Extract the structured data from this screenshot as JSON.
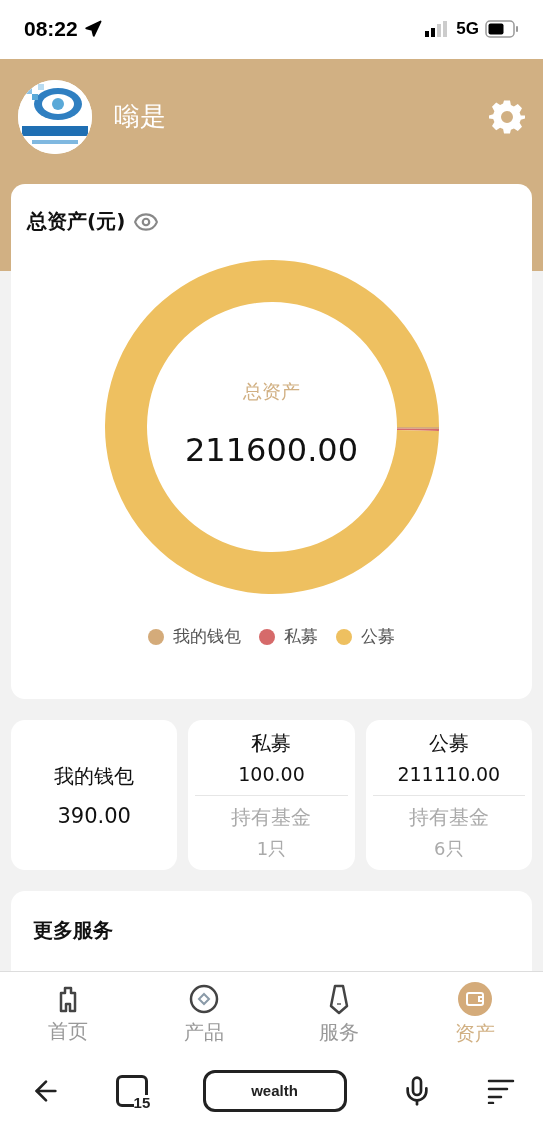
{
  "status_bar": {
    "time": "08:22",
    "network": "5G"
  },
  "profile": {
    "name": "嗡是"
  },
  "total_card": {
    "title": "总资产(元)",
    "center_value": "211600.00",
    "chart_data": {
      "type": "donut",
      "categories": [
        "我的钱包",
        "私募",
        "公募"
      ],
      "series": [
        {
          "name": "总资产",
          "values": [
            0.18,
            0.05,
            99.77
          ]
        }
      ]
    },
    "legend": [
      {
        "color": "#d4ab7a"
      },
      {
        "color": "#d66a6a"
      },
      {
        "color": "#eec060"
      }
    ]
  },
  "summary_cards": [
    {
      "kind": "wallet",
      "title": "我的钱包",
      "amount": "390.00"
    },
    {
      "kind": "fund",
      "title": "私募",
      "amount": "100.00",
      "holding_label": "持有基金",
      "holding_count": "1只"
    },
    {
      "kind": "fund",
      "title": "公募",
      "amount": "211110.00",
      "holding_label": "持有基金",
      "holding_count": "6只"
    }
  ],
  "more_services": {
    "title": "更多服务"
  },
  "tab_bar": [
    {
      "label": "首页",
      "kind": "home",
      "selected": false
    },
    {
      "label": "产品",
      "kind": "product",
      "selected": false
    },
    {
      "label": "服务",
      "kind": "service",
      "selected": false
    },
    {
      "label": "资产",
      "kind": "wallet",
      "selected": true
    }
  ],
  "browser_bar": {
    "tab_count": "15",
    "address": "wealth"
  }
}
